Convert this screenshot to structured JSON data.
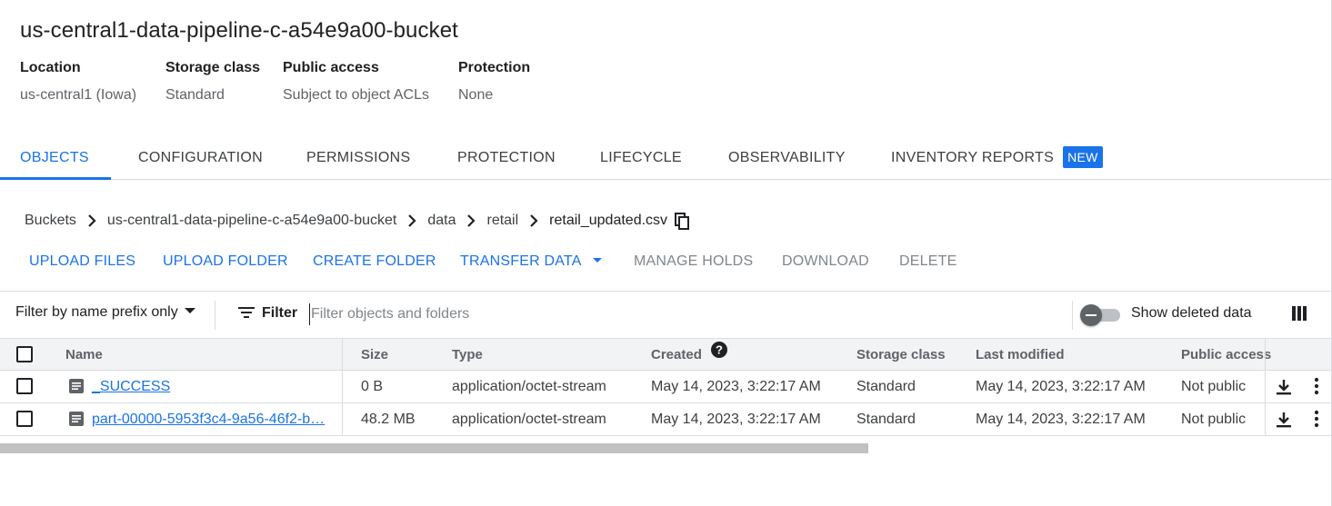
{
  "bucket": {
    "title": "us-central1-data-pipeline-c-a54e9a00-bucket",
    "meta": [
      {
        "label": "Location",
        "value": "us-central1 (Iowa)"
      },
      {
        "label": "Storage class",
        "value": "Standard"
      },
      {
        "label": "Public access",
        "value": "Subject to object ACLs"
      },
      {
        "label": "Protection",
        "value": "None"
      }
    ]
  },
  "tabs": [
    {
      "label": "OBJECTS",
      "active": true
    },
    {
      "label": "CONFIGURATION"
    },
    {
      "label": "PERMISSIONS"
    },
    {
      "label": "PROTECTION"
    },
    {
      "label": "LIFECYCLE"
    },
    {
      "label": "OBSERVABILITY"
    },
    {
      "label": "INVENTORY REPORTS",
      "badge": "NEW"
    }
  ],
  "breadcrumb": [
    "Buckets",
    "us-central1-data-pipeline-c-a54e9a00-bucket",
    "data",
    "retail",
    "retail_updated.csv"
  ],
  "actions": {
    "upload_files": "UPLOAD FILES",
    "upload_folder": "UPLOAD FOLDER",
    "create_folder": "CREATE FOLDER",
    "transfer_data": "TRANSFER DATA",
    "manage_holds": "MANAGE HOLDS",
    "download": "DOWNLOAD",
    "delete": "DELETE"
  },
  "filter": {
    "mode": "Filter by name prefix only",
    "label": "Filter",
    "placeholder": "Filter objects and folders",
    "show_deleted": "Show deleted data",
    "show_deleted_on": false
  },
  "table": {
    "headers": {
      "name": "Name",
      "size": "Size",
      "type": "Type",
      "created": "Created",
      "storage_class": "Storage class",
      "last_modified": "Last modified",
      "public_access": "Public access"
    },
    "rows": [
      {
        "name": "_SUCCESS",
        "size": "0 B",
        "type": "application/octet-stream",
        "created": "May 14, 2023, 3:22:17 AM",
        "storage_class": "Standard",
        "last_modified": "May 14, 2023, 3:22:17 AM",
        "public_access": "Not public"
      },
      {
        "name": "part-00000-5953f3c4-9a56-46f2-b…",
        "size": "48.2 MB",
        "type": "application/octet-stream",
        "created": "May 14, 2023, 3:22:17 AM",
        "storage_class": "Standard",
        "last_modified": "May 14, 2023, 3:22:17 AM",
        "public_access": "Not public"
      }
    ]
  },
  "colors": {
    "accent": "#1a73e8",
    "text": "#202124",
    "muted": "#5f6368",
    "divider": "#dadce0"
  },
  "icons": [
    "chevron-right-icon",
    "copy-icon",
    "dropdown-caret-icon",
    "filter-list-icon",
    "toggle-switch",
    "column-display-icon",
    "checkbox",
    "file-icon",
    "help-icon",
    "download-icon",
    "more-vert-icon"
  ]
}
